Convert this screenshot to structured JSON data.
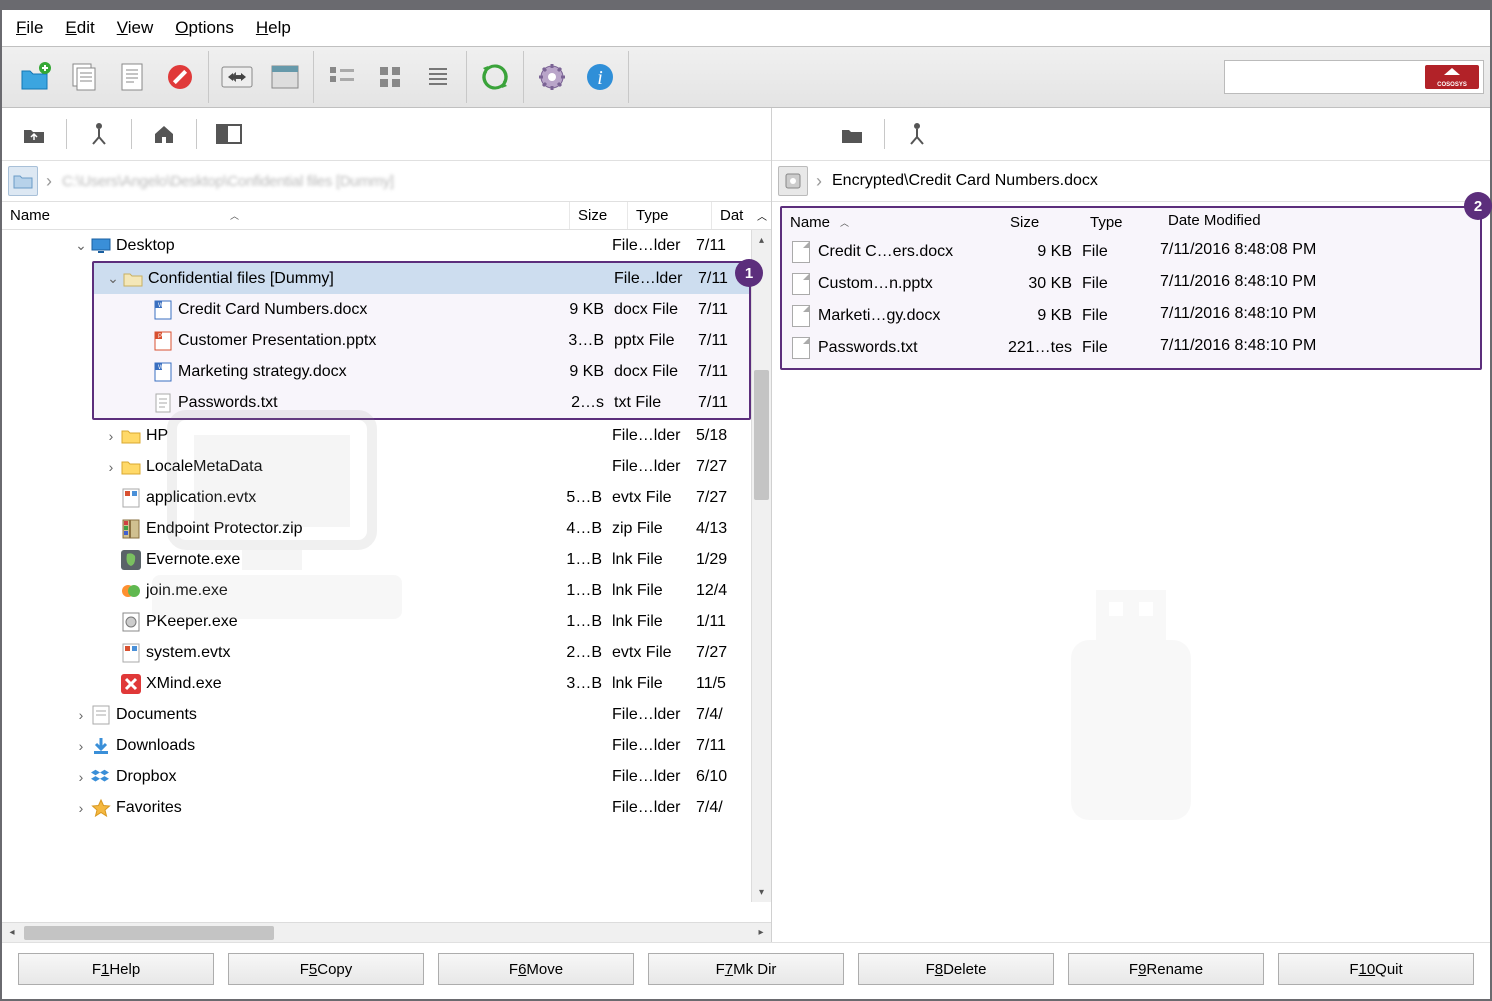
{
  "menu": {
    "file": "File",
    "edit": "Edit",
    "view": "View",
    "options": "Options",
    "help": "Help"
  },
  "breadcrumb_left": "C:\\Users\\...\\Desktop\\Confidential files [Dummy]",
  "breadcrumb_right": "Encrypted\\Credit Card Numbers.docx",
  "headers_left": {
    "name": "Name",
    "size": "Size",
    "type": "Type",
    "date": "Date"
  },
  "headers_right": {
    "name": "Name",
    "size": "Size",
    "type": "Type",
    "date": "Date Modified"
  },
  "callouts": {
    "one": "1",
    "two": "2"
  },
  "left_tree": [
    {
      "indent": 1,
      "expand": "v",
      "icon": "monitor",
      "name": "Desktop",
      "size": "",
      "type": "File…lder",
      "date": "7/11"
    },
    {
      "indent": 2,
      "expand": "v",
      "icon": "folder",
      "name": "Confidential files [Dummy]",
      "size": "",
      "type": "File…lder",
      "date": "7/11",
      "selected": true
    },
    {
      "indent": 3,
      "expand": "",
      "icon": "docx",
      "name": "Credit Card Numbers.docx",
      "size": "9 KB",
      "type": "docx File",
      "date": "7/11"
    },
    {
      "indent": 3,
      "expand": "",
      "icon": "pptx",
      "name": "Customer Presentation.pptx",
      "size": "3…B",
      "type": "pptx File",
      "date": "7/11"
    },
    {
      "indent": 3,
      "expand": "",
      "icon": "docx",
      "name": "Marketing strategy.docx",
      "size": "9 KB",
      "type": "docx File",
      "date": "7/11"
    },
    {
      "indent": 3,
      "expand": "",
      "icon": "txt",
      "name": "Passwords.txt",
      "size": "2…s",
      "type": "txt File",
      "date": "7/11"
    },
    {
      "indent": 2,
      "expand": ">",
      "icon": "folder-y",
      "name": "HP",
      "size": "",
      "type": "File…lder",
      "date": "5/18"
    },
    {
      "indent": 2,
      "expand": ">",
      "icon": "folder-y",
      "name": "LocaleMetaData",
      "size": "",
      "type": "File…lder",
      "date": "7/27"
    },
    {
      "indent": 2,
      "expand": "",
      "icon": "evtx",
      "name": "application.evtx",
      "size": "5…B",
      "type": "evtx File",
      "date": "7/27"
    },
    {
      "indent": 2,
      "expand": "",
      "icon": "zip",
      "name": "Endpoint Protector.zip",
      "size": "4…B",
      "type": "zip File",
      "date": "4/13"
    },
    {
      "indent": 2,
      "expand": "",
      "icon": "evernote",
      "name": "Evernote.exe",
      "size": "1…B",
      "type": "lnk File",
      "date": "1/29"
    },
    {
      "indent": 2,
      "expand": "",
      "icon": "joinme",
      "name": "join.me.exe",
      "size": "1…B",
      "type": "lnk File",
      "date": "12/4"
    },
    {
      "indent": 2,
      "expand": "",
      "icon": "exe",
      "name": "PKeeper.exe",
      "size": "1…B",
      "type": "lnk File",
      "date": "1/11"
    },
    {
      "indent": 2,
      "expand": "",
      "icon": "evtx",
      "name": "system.evtx",
      "size": "2…B",
      "type": "evtx File",
      "date": "7/27"
    },
    {
      "indent": 2,
      "expand": "",
      "icon": "xmind",
      "name": "XMind.exe",
      "size": "3…B",
      "type": "lnk File",
      "date": "11/5"
    },
    {
      "indent": 1,
      "expand": ">",
      "icon": "doc-folder",
      "name": "Documents",
      "size": "",
      "type": "File…lder",
      "date": "7/4/"
    },
    {
      "indent": 1,
      "expand": ">",
      "icon": "downloads",
      "name": "Downloads",
      "size": "",
      "type": "File…lder",
      "date": "7/11"
    },
    {
      "indent": 1,
      "expand": ">",
      "icon": "dropbox",
      "name": "Dropbox",
      "size": "",
      "type": "File…lder",
      "date": "6/10"
    },
    {
      "indent": 1,
      "expand": ">",
      "icon": "favorites",
      "name": "Favorites",
      "size": "",
      "type": "File…lder",
      "date": "7/4/"
    }
  ],
  "right_list": [
    {
      "name": "Credit C…ers.docx",
      "size": "9 KB",
      "type": "File",
      "date": "7/11/2016 8:48:08 PM"
    },
    {
      "name": "Custom…n.pptx",
      "size": "30 KB",
      "type": "File",
      "date": "7/11/2016 8:48:10 PM"
    },
    {
      "name": "Marketi…gy.docx",
      "size": "9 KB",
      "type": "File",
      "date": "7/11/2016 8:48:10 PM"
    },
    {
      "name": "Passwords.txt",
      "size": "221…tes",
      "type": "File",
      "date": "7/11/2016 8:48:10 PM"
    }
  ],
  "footer": [
    {
      "key": "F1",
      "label": "Help"
    },
    {
      "key": "F5",
      "label": "Copy"
    },
    {
      "key": "F6",
      "label": "Move"
    },
    {
      "key": "F7",
      "label": "Mk Dir"
    },
    {
      "key": "F8",
      "label": "Delete"
    },
    {
      "key": "F9",
      "label": "Rename"
    },
    {
      "key": "F10",
      "label": "Quit"
    }
  ]
}
